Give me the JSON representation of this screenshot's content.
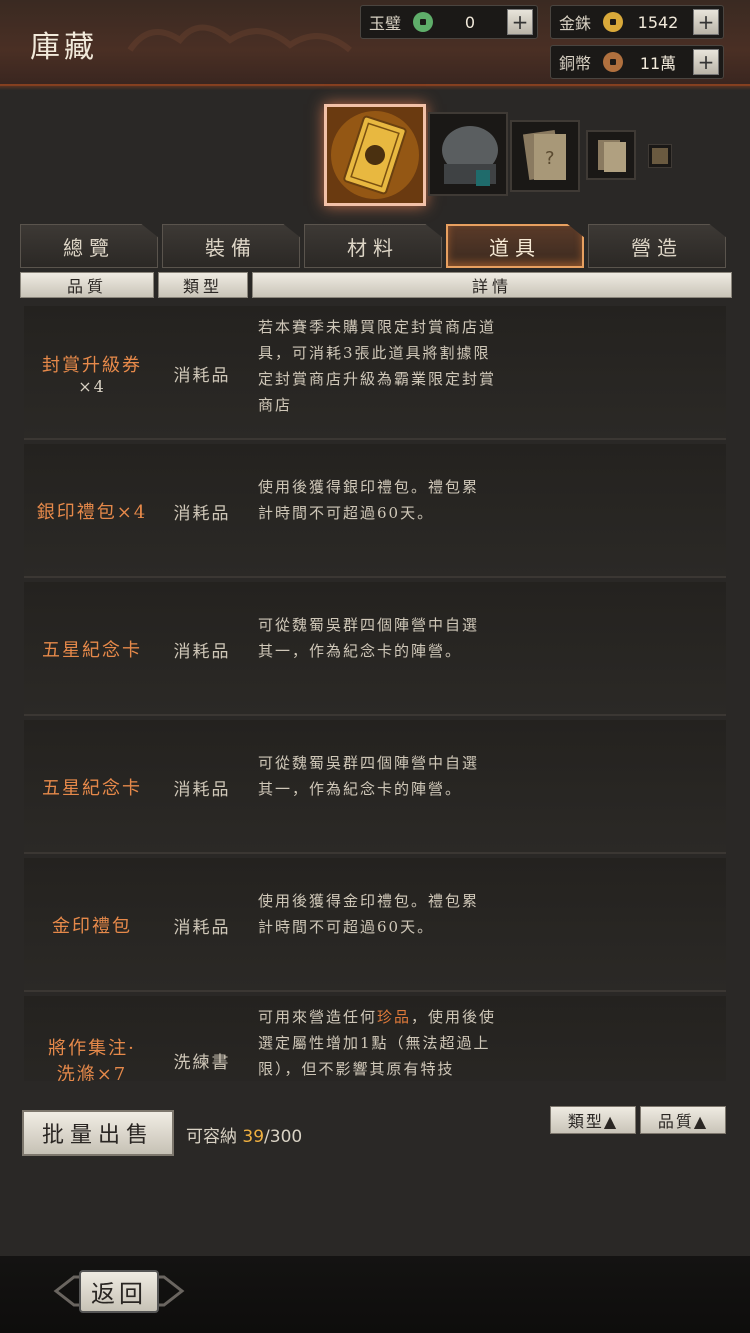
{
  "header": {
    "title": "庫藏",
    "currencies": [
      {
        "label": "玉璧",
        "value": "0",
        "icon": "jade-coin-icon",
        "color": "#5fae6a"
      },
      {
        "label": "金銖",
        "value": "1542",
        "icon": "gold-coin-icon",
        "color": "#d9a93a"
      },
      {
        "label": "銅幣",
        "value": "11萬",
        "icon": "copper-coin-icon",
        "color": "#b0703e"
      }
    ]
  },
  "tabs": [
    {
      "label": "總覽"
    },
    {
      "label": "裝備"
    },
    {
      "label": "材料"
    },
    {
      "label": "道具",
      "active": true
    },
    {
      "label": "營造"
    }
  ],
  "columns": {
    "quality": "品質",
    "type": "類型",
    "detail": "詳情"
  },
  "items": [
    {
      "name": "封賞升級券",
      "qty": "×4",
      "type": "消耗品",
      "desc": [
        "若本賽季未購買限定封賞商店道",
        "具，可消耗3張此道具將割據限",
        "定封賞商店升級為霸業限定封賞",
        "商店"
      ]
    },
    {
      "name": "銀印禮包×4",
      "qty": "",
      "type": "消耗品",
      "desc": [
        "使用後獲得銀印禮包。禮包累",
        "計時間不可超過60天。"
      ]
    },
    {
      "name": "五星紀念卡",
      "qty": "",
      "type": "消耗品",
      "desc": [
        "可從魏蜀吳群四個陣營中自選",
        "其一，作為紀念卡的陣營。"
      ]
    },
    {
      "name": "五星紀念卡",
      "qty": "",
      "type": "消耗品",
      "desc": [
        "可從魏蜀吳群四個陣營中自選",
        "其一，作為紀念卡的陣營。"
      ]
    },
    {
      "name": "金印禮包",
      "qty": "",
      "type": "消耗品",
      "desc": [
        "使用後獲得金印禮包。禮包累",
        "計時間不可超過60天。"
      ]
    },
    {
      "name": "將作集注·",
      "qty": "洗滌×7",
      "type": "洗練書",
      "desc_parts": [
        [
          "可用來營造任何",
          ""
        ],
        [
          "珍品",
          "hl"
        ],
        [
          "，使用後使",
          ""
        ]
      ],
      "desc": [
        "選定屬性增加1點（無法超過上",
        "限），但不影響其原有特技"
      ]
    }
  ],
  "bottom": {
    "batch_sell": "批量出售",
    "capacity_label": "可容納",
    "capacity_used": "39",
    "capacity_total": "/300",
    "sort_type": "類型▲",
    "sort_quality": "品質▲"
  },
  "footer": {
    "back": "返回"
  }
}
